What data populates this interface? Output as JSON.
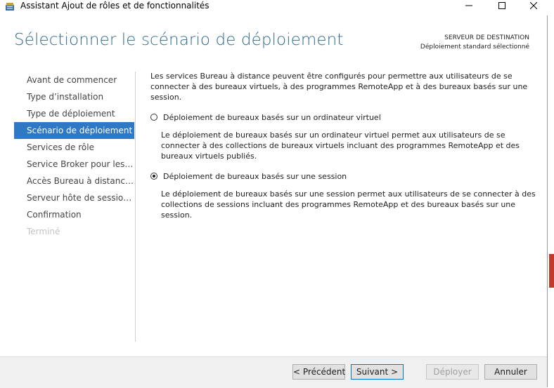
{
  "window": {
    "title": "Assistant Ajout de rôles et de fonctionnalités"
  },
  "header": {
    "title": "Sélectionner le scénario de déploiement",
    "destination_label": "SERVEUR DE DESTINATION",
    "destination_value": "Déploiement standard sélectionné"
  },
  "nav": {
    "items": [
      {
        "label": "Avant de commencer"
      },
      {
        "label": "Type d’installation"
      },
      {
        "label": "Type de déploiement"
      },
      {
        "label": "Scénario de déploiement"
      },
      {
        "label": "Services de rôle"
      },
      {
        "label": "Service Broker pour les c..."
      },
      {
        "label": "Accès Bureau à distance..."
      },
      {
        "label": "Serveur hôte de session B..."
      },
      {
        "label": "Confirmation"
      },
      {
        "label": "Terminé"
      }
    ]
  },
  "content": {
    "intro": "Les services Bureau à distance peuvent être configurés pour permettre aux utilisateurs de se connecter à des bureaux virtuels, à des programmes RemoteApp et à des bureaux basés sur une session.",
    "options": [
      {
        "label": "Déploiement de bureaux basés sur un ordinateur virtuel",
        "selected": false,
        "description": "Le déploiement de bureaux basés sur un ordinateur virtuel permet aux utilisateurs de se connecter à des collections de bureaux virtuels incluant des programmes RemoteApp et des bureaux virtuels publiés."
      },
      {
        "label": "Déploiement de bureaux basés sur une session",
        "selected": true,
        "description": "Le déploiement de bureaux basés sur une session permet aux utilisateurs de se connecter à des collections de sessions incluant des programmes RemoteApp et des bureaux basés sur une session."
      }
    ]
  },
  "footer": {
    "previous": "< Précédent",
    "next": "Suivant >",
    "deploy": "Déployer",
    "cancel": "Annuler"
  },
  "colors": {
    "accent": "#2f78c4",
    "title": "#2d6a8e"
  }
}
